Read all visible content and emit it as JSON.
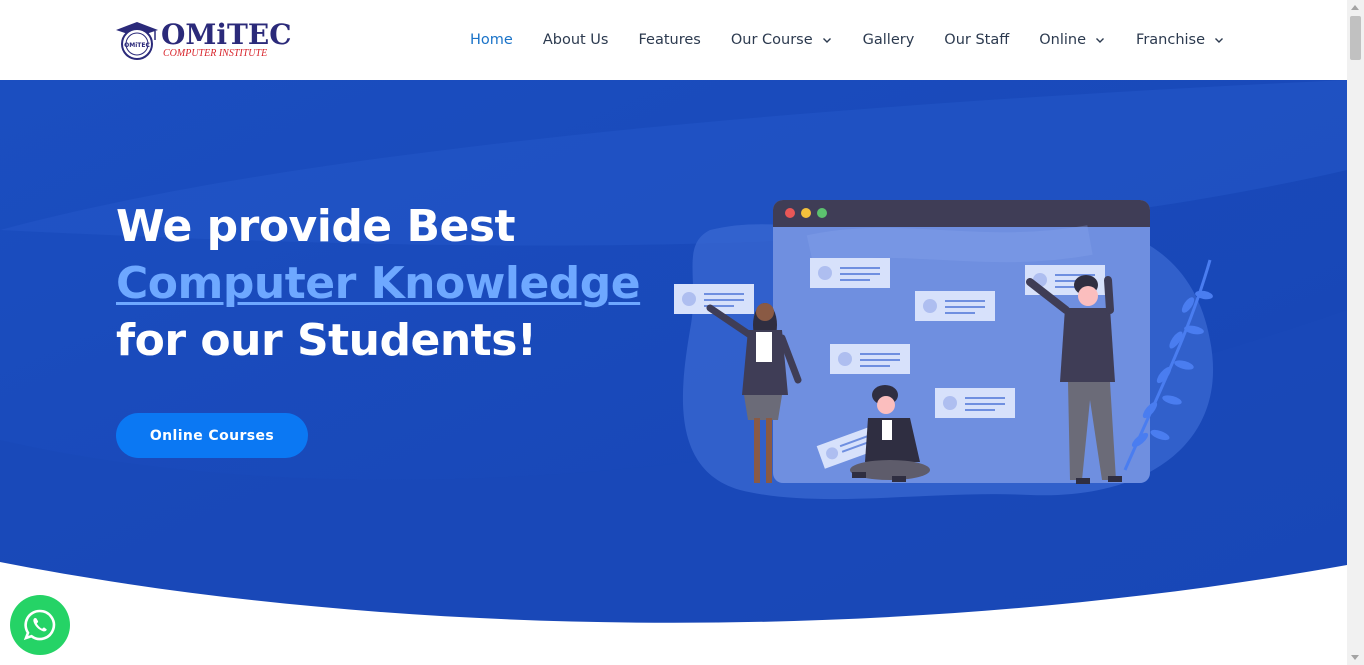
{
  "brand": {
    "name": "OMiTEC",
    "tagline": "COMPUTER INSTITUTE",
    "emblem_text": "OMiTEC",
    "colors": {
      "primary": "#2b2a7a",
      "accent": "#d8232a"
    }
  },
  "nav": {
    "items": [
      {
        "label": "Home",
        "active": true,
        "dropdown": false
      },
      {
        "label": "About Us",
        "active": false,
        "dropdown": false
      },
      {
        "label": "Features",
        "active": false,
        "dropdown": false
      },
      {
        "label": "Our Course",
        "active": false,
        "dropdown": true
      },
      {
        "label": "Gallery",
        "active": false,
        "dropdown": false
      },
      {
        "label": "Our Staff",
        "active": false,
        "dropdown": false
      },
      {
        "label": "Online",
        "active": false,
        "dropdown": true
      },
      {
        "label": "Franchise",
        "active": false,
        "dropdown": true
      }
    ],
    "chevron_icon": "chevron-down-icon",
    "active_color": "#1a73c8",
    "text_color": "#2c3a4f"
  },
  "hero": {
    "line1": "We provide Best",
    "line2": "Computer Knowledge",
    "line3": "for our Students!",
    "cta_label": "Online Courses",
    "colors": {
      "background": "#1d4fc4",
      "highlight": "#6ea8ff",
      "cta": "#0b78f3"
    },
    "illustration": "people-interacting-with-browser-window-illustration"
  },
  "floating": {
    "whatsapp_icon": "whatsapp-icon",
    "color": "#25d366"
  }
}
